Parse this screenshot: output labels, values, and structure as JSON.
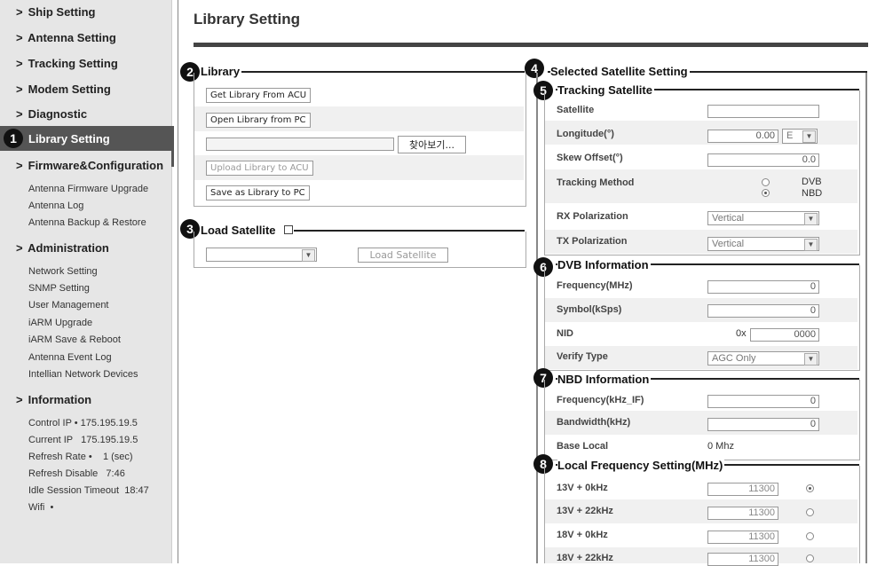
{
  "sidebar": {
    "top": [
      "Ship Setting",
      "Antenna Setting",
      "Tracking Setting",
      "Modem Setting",
      "Diagnostic"
    ],
    "active": "Library Setting",
    "firmware": "Firmware&Configuration",
    "firmware_items": [
      "Antenna Firmware Upgrade",
      "Antenna Log",
      "Antenna Backup & Restore"
    ],
    "admin": "Administration",
    "admin_items": [
      "Network Setting",
      "SNMP Setting",
      "User Management",
      "iARM Upgrade",
      "iARM Save & Reboot",
      "Antenna Event Log",
      "Intellian Network Devices"
    ],
    "information": "Information",
    "info_items": [
      "Control IP • 175.195.19.5",
      "Current IP   175.195.19.5",
      "Refresh Rate •    1 (sec)",
      "Refresh Disable   7:46",
      "Idle Session Timeout  18:47",
      "Wifi  •"
    ]
  },
  "badges": [
    "1",
    "2",
    "3",
    "4",
    "5",
    "6",
    "7",
    "8"
  ],
  "page_title": "Library Setting",
  "library": {
    "title": "Library",
    "get_btn": "Get Library From ACU",
    "open_btn": "Open Library from PC",
    "browse_btn": "찾아보기...",
    "upload_btn": "Upload Library to ACU",
    "save_btn": "Save as Library to PC"
  },
  "load_satellite": {
    "title": "Load Satellite",
    "button": "Load Satellite"
  },
  "selected": {
    "title": "Selected Satellite Setting",
    "tracking": {
      "title": "Tracking Satellite",
      "satellite_label": "Satellite",
      "satellite_value": "",
      "longitude_label": "Longitude(°)",
      "longitude_value": "0.00",
      "longitude_dir": "E",
      "skew_label": "Skew Offset(°)",
      "skew_value": "0.0",
      "method_label": "Tracking Method",
      "method_dvb": "DVB",
      "method_nbd": "NBD",
      "rx_label": "RX Polarization",
      "rx_value": "Vertical",
      "tx_label": "TX Polarization",
      "tx_value": "Vertical"
    },
    "dvb": {
      "title": "DVB Information",
      "freq_label": "Frequency(MHz)",
      "freq_value": "0",
      "symbol_label": "Symbol(kSps)",
      "symbol_value": "0",
      "nid_label": "NID",
      "nid_prefix": "0x",
      "nid_value": "0000",
      "verify_label": "Verify Type",
      "verify_value": "AGC Only"
    },
    "nbd": {
      "title": "NBD Information",
      "freq_label": "Frequency(kHz_IF)",
      "freq_value": "0",
      "bw_label": "Bandwidth(kHz)",
      "bw_value": "0",
      "base_label": "Base Local",
      "base_value": "0 Mhz"
    },
    "local": {
      "title": "Local Frequency Setting(MHz)",
      "rows": [
        {
          "label": "13V + 0kHz",
          "value": "11300"
        },
        {
          "label": "13V + 22kHz",
          "value": "11300"
        },
        {
          "label": "18V + 0kHz",
          "value": "11300"
        },
        {
          "label": "18V + 22kHz",
          "value": "11300"
        }
      ]
    }
  }
}
